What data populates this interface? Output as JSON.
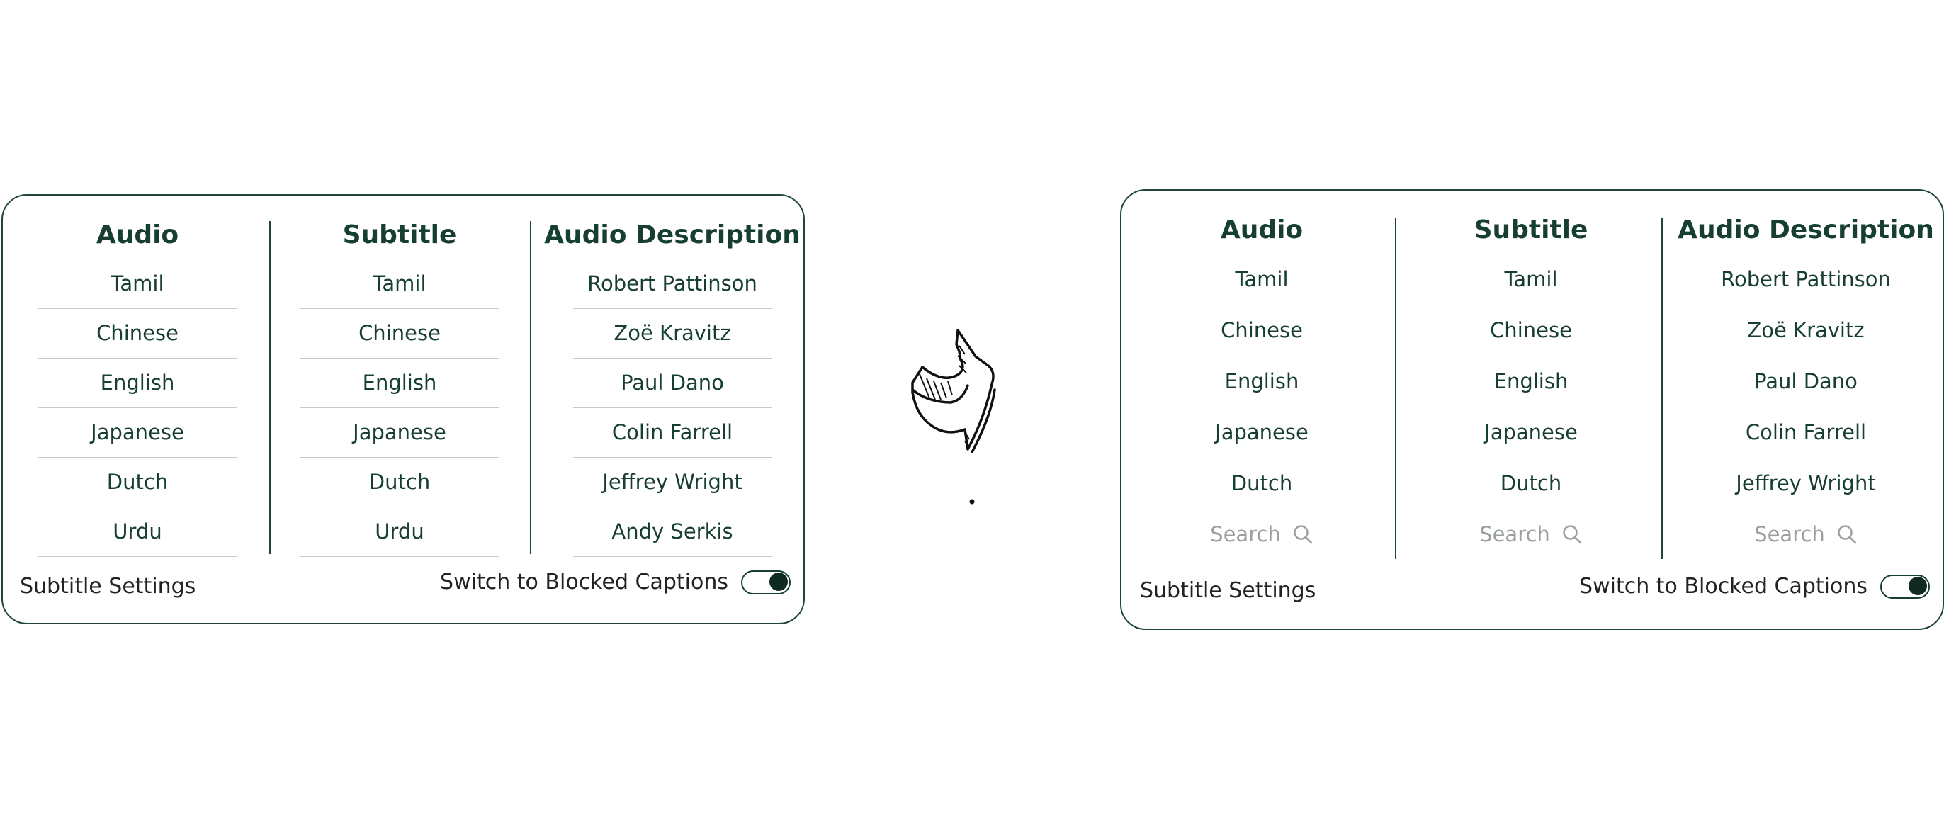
{
  "before": {
    "columns": {
      "audio": {
        "title": "Audio",
        "items": [
          "Tamil",
          "Chinese",
          "English",
          "Japanese",
          "Dutch",
          "Urdu"
        ]
      },
      "subtitle": {
        "title": "Subtitle",
        "items": [
          "Tamil",
          "Chinese",
          "English",
          "Japanese",
          "Dutch",
          "Urdu"
        ]
      },
      "description": {
        "title": "Audio Description",
        "items": [
          "Robert Pattinson",
          "Zoë Kravitz",
          "Paul Dano",
          "Colin Farrell",
          "Jeffrey Wright",
          "Andy Serkis"
        ]
      }
    },
    "footer": {
      "settings_label": "Subtitle Settings",
      "toggle_label": "Switch to Blocked Captions",
      "toggle_on": true
    }
  },
  "after": {
    "columns": {
      "audio": {
        "title": "Audio",
        "items": [
          "Tamil",
          "Chinese",
          "English",
          "Japanese",
          "Dutch"
        ],
        "search_placeholder": "Search"
      },
      "subtitle": {
        "title": "Subtitle",
        "items": [
          "Tamil",
          "Chinese",
          "English",
          "Japanese",
          "Dutch"
        ],
        "search_placeholder": "Search"
      },
      "description": {
        "title": "Audio Description",
        "items": [
          "Robert Pattinson",
          "Zoë Kravitz",
          "Paul Dano",
          "Colin Farrell",
          "Jeffrey Wright"
        ],
        "search_placeholder": "Search"
      }
    },
    "footer": {
      "settings_label": "Subtitle Settings",
      "toggle_label": "Switch to Blocked Captions",
      "toggle_on": true
    }
  },
  "icons": {
    "transition_arrow": "hand-drawn-curved-arrow-icon",
    "search": "search-icon"
  },
  "colors": {
    "text": "#173f31",
    "border": "#1e4538",
    "search_text": "#9aa09d",
    "toggle_knob": "#0e2a22"
  }
}
